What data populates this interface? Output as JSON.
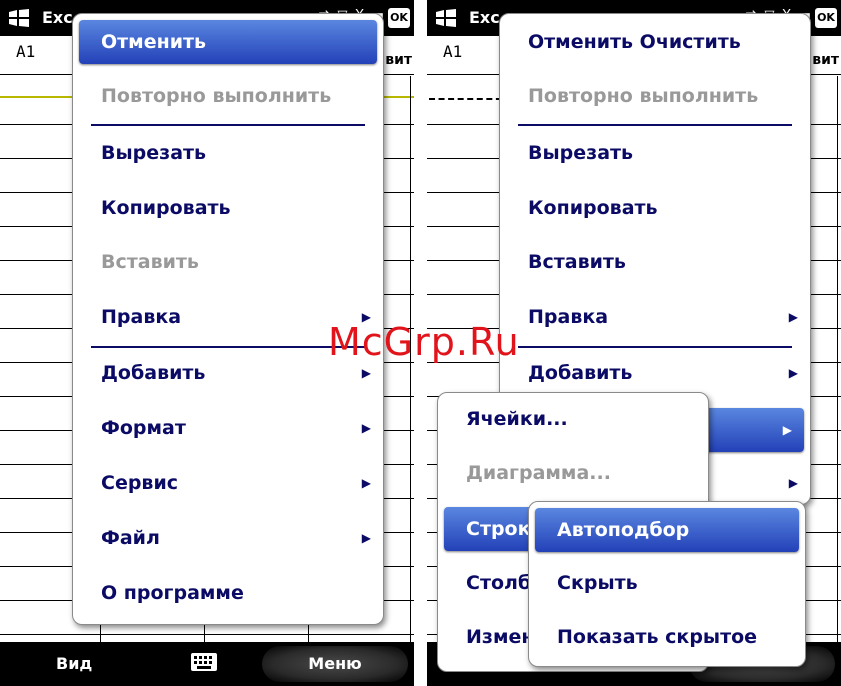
{
  "left": {
    "title": "Exc",
    "cell_ref": "A1",
    "softkey_left": "Вид",
    "softkey_right": "Меню",
    "menu": {
      "items": [
        {
          "label": "Отменить",
          "state": "highlighted"
        },
        {
          "label": "Повторно выполнить",
          "state": "disabled"
        },
        {
          "label": "Вырезать",
          "state": "enabled"
        },
        {
          "label": "Копировать",
          "state": "enabled"
        },
        {
          "label": "Вставить",
          "state": "disabled"
        },
        {
          "label": "Правка",
          "state": "enabled",
          "submenu": true
        },
        {
          "label": "Добавить",
          "state": "enabled",
          "submenu": true
        },
        {
          "label": "Формат",
          "state": "enabled",
          "submenu": true
        },
        {
          "label": "Сервис",
          "state": "enabled",
          "submenu": true
        },
        {
          "label": "Файл",
          "state": "enabled",
          "submenu": true
        },
        {
          "label": "О программе",
          "state": "enabled"
        }
      ]
    },
    "col_header_fragment": "вит"
  },
  "right": {
    "title": "Exc",
    "cell_ref": "A1",
    "col_header_fragment": "вит",
    "menu": {
      "items": [
        {
          "label": "Отменить Очистить",
          "state": "enabled"
        },
        {
          "label": "Повторно выполнить",
          "state": "disabled"
        },
        {
          "label": "Вырезать",
          "state": "enabled"
        },
        {
          "label": "Копировать",
          "state": "enabled"
        },
        {
          "label": "Вставить",
          "state": "enabled"
        },
        {
          "label": "Правка",
          "state": "enabled",
          "submenu": true
        },
        {
          "label": "Добавить",
          "state": "enabled",
          "submenu": true
        }
      ]
    },
    "format_submenu": {
      "items": [
        {
          "label": "Ячейки...",
          "state": "enabled"
        },
        {
          "label": "Диаграмма...",
          "state": "disabled"
        },
        {
          "label": "Строк",
          "state": "highlighted"
        },
        {
          "label": "Столб",
          "state": "enabled"
        },
        {
          "label": "Измен",
          "state": "enabled"
        }
      ]
    },
    "rows_submenu": {
      "items": [
        {
          "label": "Автоподбор",
          "state": "highlighted"
        },
        {
          "label": "Скрыть",
          "state": "enabled"
        },
        {
          "label": "Показать скрытое",
          "state": "enabled"
        }
      ]
    }
  },
  "watermark": "McGrp.Ru",
  "status_icons": "⇄ ▽ Y ▬",
  "ok_label": "OK",
  "icons": {
    "windows": "windows-logo-icon",
    "keyboard": "keyboard-icon",
    "submenu_arrow": "▶"
  },
  "colors": {
    "menu_text": "#0b0b66",
    "highlight": "#2341b8",
    "watermark": "#e1141c"
  }
}
